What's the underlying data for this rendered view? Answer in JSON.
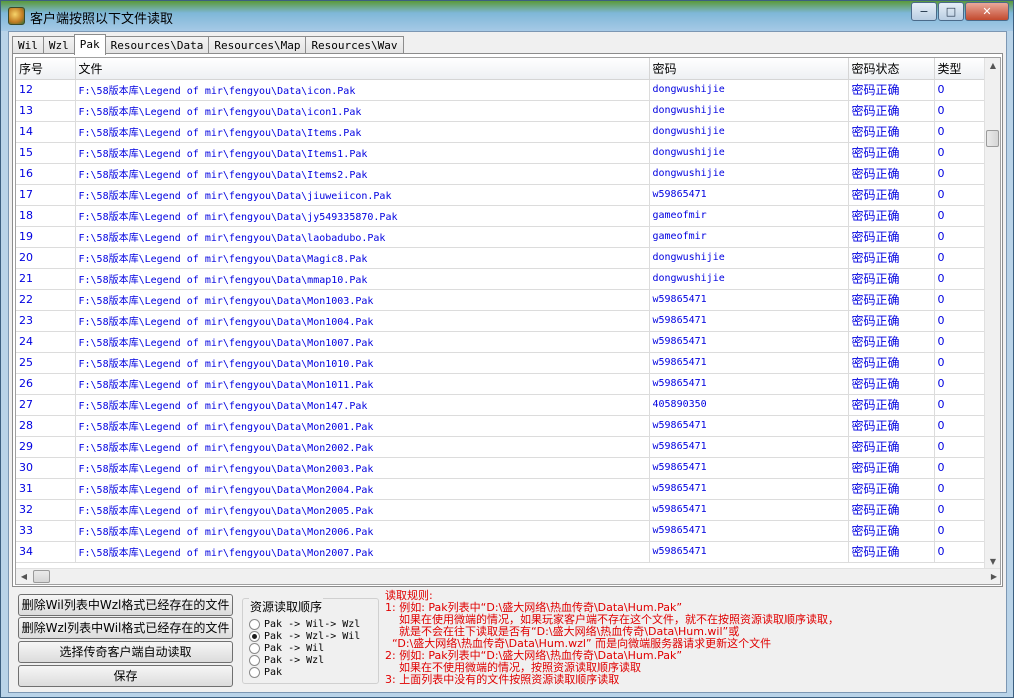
{
  "window": {
    "title": "客户端按照以下文件读取",
    "min_glyph": "−",
    "max_glyph": "□",
    "close_glyph": "✕"
  },
  "tabs": [
    {
      "label": "Wil",
      "active": false
    },
    {
      "label": "Wzl",
      "active": false
    },
    {
      "label": "Pak",
      "active": true
    },
    {
      "label": "Resources\\Data",
      "active": false
    },
    {
      "label": "Resources\\Map",
      "active": false
    },
    {
      "label": "Resources\\Wav",
      "active": false
    }
  ],
  "grid": {
    "columns": [
      "序号",
      "文件",
      "密码",
      "密码状态",
      "类型"
    ],
    "rows": [
      [
        "12",
        "F:\\58版本库\\Legend of mir\\fengyou\\Data\\icon.Pak",
        "dongwushijie",
        "密码正确",
        "0"
      ],
      [
        "13",
        "F:\\58版本库\\Legend of mir\\fengyou\\Data\\icon1.Pak",
        "dongwushijie",
        "密码正确",
        "0"
      ],
      [
        "14",
        "F:\\58版本库\\Legend of mir\\fengyou\\Data\\Items.Pak",
        "dongwushijie",
        "密码正确",
        "0"
      ],
      [
        "15",
        "F:\\58版本库\\Legend of mir\\fengyou\\Data\\Items1.Pak",
        "dongwushijie",
        "密码正确",
        "0"
      ],
      [
        "16",
        "F:\\58版本库\\Legend of mir\\fengyou\\Data\\Items2.Pak",
        "dongwushijie",
        "密码正确",
        "0"
      ],
      [
        "17",
        "F:\\58版本库\\Legend of mir\\fengyou\\Data\\jiuweiicon.Pak",
        "w59865471",
        "密码正确",
        "0"
      ],
      [
        "18",
        "F:\\58版本库\\Legend of mir\\fengyou\\Data\\jy549335870.Pak",
        "gameofmir",
        "密码正确",
        "0"
      ],
      [
        "19",
        "F:\\58版本库\\Legend of mir\\fengyou\\Data\\laobadubo.Pak",
        "gameofmir",
        "密码正确",
        "0"
      ],
      [
        "20",
        "F:\\58版本库\\Legend of mir\\fengyou\\Data\\Magic8.Pak",
        "dongwushijie",
        "密码正确",
        "0"
      ],
      [
        "21",
        "F:\\58版本库\\Legend of mir\\fengyou\\Data\\mmap10.Pak",
        "dongwushijie",
        "密码正确",
        "0"
      ],
      [
        "22",
        "F:\\58版本库\\Legend of mir\\fengyou\\Data\\Mon1003.Pak",
        "w59865471",
        "密码正确",
        "0"
      ],
      [
        "23",
        "F:\\58版本库\\Legend of mir\\fengyou\\Data\\Mon1004.Pak",
        "w59865471",
        "密码正确",
        "0"
      ],
      [
        "24",
        "F:\\58版本库\\Legend of mir\\fengyou\\Data\\Mon1007.Pak",
        "w59865471",
        "密码正确",
        "0"
      ],
      [
        "25",
        "F:\\58版本库\\Legend of mir\\fengyou\\Data\\Mon1010.Pak",
        "w59865471",
        "密码正确",
        "0"
      ],
      [
        "26",
        "F:\\58版本库\\Legend of mir\\fengyou\\Data\\Mon1011.Pak",
        "w59865471",
        "密码正确",
        "0"
      ],
      [
        "27",
        "F:\\58版本库\\Legend of mir\\fengyou\\Data\\Mon147.Pak",
        "405890350",
        "密码正确",
        "0"
      ],
      [
        "28",
        "F:\\58版本库\\Legend of mir\\fengyou\\Data\\Mon2001.Pak",
        "w59865471",
        "密码正确",
        "0"
      ],
      [
        "29",
        "F:\\58版本库\\Legend of mir\\fengyou\\Data\\Mon2002.Pak",
        "w59865471",
        "密码正确",
        "0"
      ],
      [
        "30",
        "F:\\58版本库\\Legend of mir\\fengyou\\Data\\Mon2003.Pak",
        "w59865471",
        "密码正确",
        "0"
      ],
      [
        "31",
        "F:\\58版本库\\Legend of mir\\fengyou\\Data\\Mon2004.Pak",
        "w59865471",
        "密码正确",
        "0"
      ],
      [
        "32",
        "F:\\58版本库\\Legend of mir\\fengyou\\Data\\Mon2005.Pak",
        "w59865471",
        "密码正确",
        "0"
      ],
      [
        "33",
        "F:\\58版本库\\Legend of mir\\fengyou\\Data\\Mon2006.Pak",
        "w59865471",
        "密码正确",
        "0"
      ],
      [
        "34",
        "F:\\58版本库\\Legend of mir\\fengyou\\Data\\Mon2007.Pak",
        "w59865471",
        "密码正确",
        "0"
      ]
    ]
  },
  "buttons": {
    "delete_wil": "删除Wil列表中Wzl格式已经存在的文件",
    "delete_wzl": "删除Wzl列表中Wil格式已经存在的文件",
    "auto_read": "选择传奇客户端自动读取",
    "save": "保存"
  },
  "read_order": {
    "title": "资源读取顺序",
    "options": [
      {
        "label": "Pak -> Wil-> Wzl",
        "selected": false
      },
      {
        "label": "Pak -> Wzl-> Wil",
        "selected": true
      },
      {
        "label": "Pak -> Wil",
        "selected": false
      },
      {
        "label": "Pak -> Wzl",
        "selected": false
      },
      {
        "label": "Pak",
        "selected": false
      }
    ]
  },
  "rules": [
    "读取规则:",
    "1: 例如: Pak列表中“D:\\盛大网络\\热血传奇\\Data\\Hum.Pak”",
    "    如果在使用微端的情况，如果玩家客户端不存在这个文件，就不在按照资源读取顺序读取，",
    "    就是不会在往下读取是否有“D:\\盛大网络\\热血传奇\\Data\\Hum.wil”或",
    "  “D:\\盛大网络\\热血传奇\\Data\\Hum.wzl” 而是向微端服务器请求更新这个文件",
    "2: 例如: Pak列表中“D:\\盛大网络\\热血传奇\\Data\\Hum.Pak”",
    "    如果在不使用微端的情况，按照资源读取顺序读取",
    "3: 上面列表中没有的文件按照资源读取顺序读取"
  ]
}
